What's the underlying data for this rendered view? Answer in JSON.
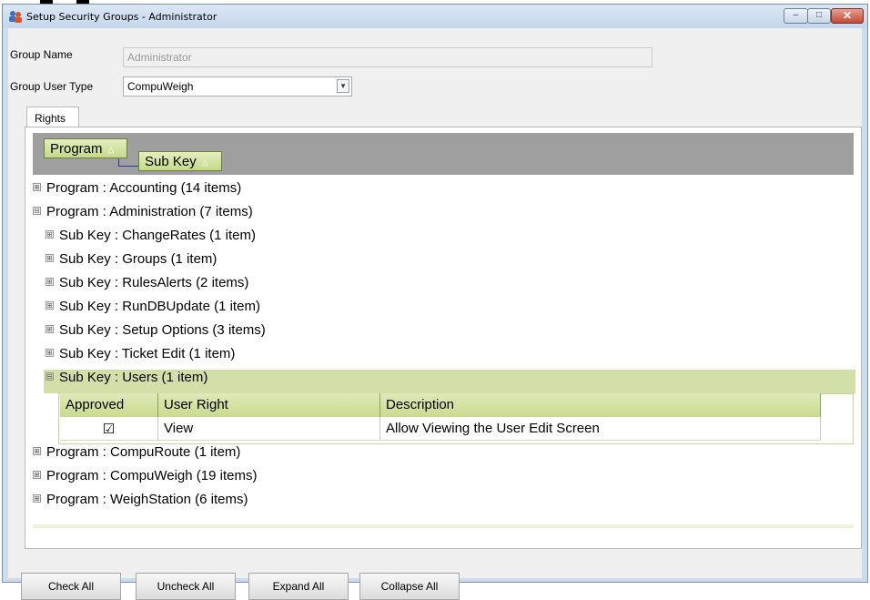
{
  "window": {
    "title": "Setup Security Groups - Administrator",
    "icon": "users-icon",
    "controls": {
      "minimize": "–",
      "maximize": "□",
      "close": "✕"
    }
  },
  "form": {
    "group_name_label": "Group Name",
    "group_name_value": "Administrator",
    "group_user_type_label": "Group User Type",
    "group_user_type_value": "CompuWeigh"
  },
  "tabs": [
    {
      "label": "Rights",
      "selected": true
    }
  ],
  "grouping": {
    "chips": [
      {
        "label": "Program",
        "sort": "△"
      },
      {
        "label": "Sub Key",
        "sort": "△"
      }
    ]
  },
  "tree": {
    "rows": [
      {
        "text": "Program : Accounting (14 items)",
        "toggle": "⊞",
        "level": 0
      },
      {
        "text": "Program : Administration (7 items)",
        "toggle": "⊟",
        "level": 0
      },
      {
        "text": "Sub Key : ChangeRates (1 item)",
        "toggle": "⊞",
        "level": 1
      },
      {
        "text": "Sub Key : Groups (1 item)",
        "toggle": "⊞",
        "level": 1
      },
      {
        "text": "Sub Key : RulesAlerts (2 items)",
        "toggle": "⊞",
        "level": 1
      },
      {
        "text": "Sub Key : RunDBUpdate (1 item)",
        "toggle": "⊞",
        "level": 1
      },
      {
        "text": "Sub Key : Setup Options (3 items)",
        "toggle": "⊞",
        "level": 1
      },
      {
        "text": "Sub Key : Ticket Edit (1 item)",
        "toggle": "⊞",
        "level": 1
      },
      {
        "text": "Sub Key : Users (1 item)",
        "toggle": "⊟",
        "level": 1,
        "selected": true
      }
    ],
    "rows_after": [
      {
        "text": "Program : CompuRoute (1 item)",
        "toggle": "⊞",
        "level": 0
      },
      {
        "text": "Program : CompuWeigh (19 items)",
        "toggle": "⊞",
        "level": 0
      },
      {
        "text": "Program : WeighStation (6 items)",
        "toggle": "⊞",
        "level": 0
      }
    ]
  },
  "rights_grid": {
    "columns": [
      "Approved",
      "User Right",
      "Description"
    ],
    "rows": [
      {
        "approved": "☑",
        "user_right": "View",
        "description": "Allow Viewing the User Edit Screen"
      }
    ]
  },
  "buttons": {
    "check_all": "Check All",
    "uncheck_all": "Uncheck All",
    "expand_all": "Expand All",
    "collapse_all": "Collapse All"
  },
  "colors": {
    "group_header_bg": "#9f9f9f",
    "selected_row_bg": "#d2dfa8",
    "chip_bg": "#c6d98a"
  }
}
